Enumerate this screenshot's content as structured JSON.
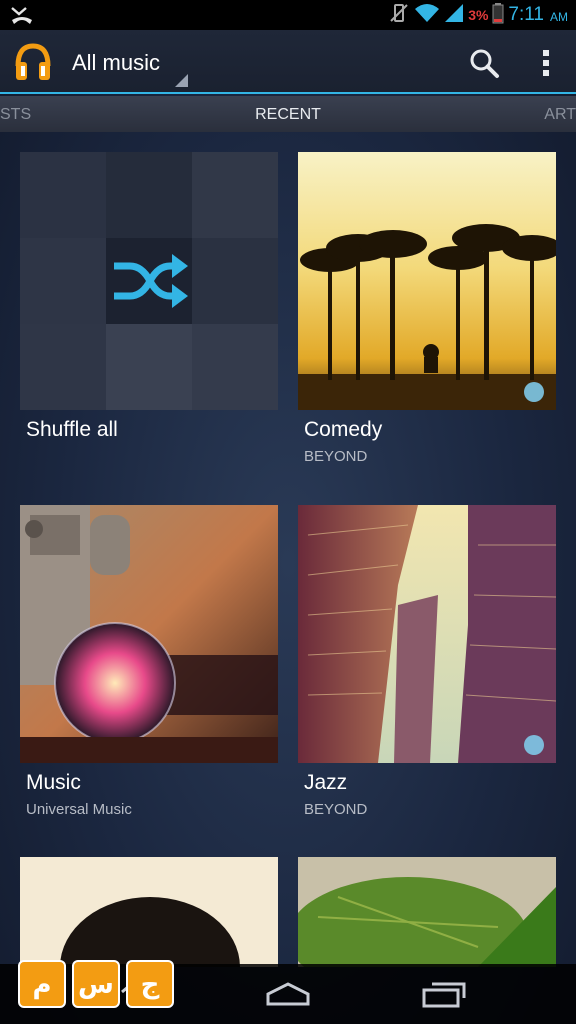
{
  "status_bar": {
    "battery_percent": "3%",
    "time": "7:11",
    "ampm": "AM"
  },
  "action_bar": {
    "title": "All music"
  },
  "tabs": {
    "left": "STS",
    "current": "RECENT",
    "right": "ART"
  },
  "tiles": [
    {
      "title": "Shuffle all",
      "subtitle": ""
    },
    {
      "title": "Comedy",
      "subtitle": "BEYOND"
    },
    {
      "title": "Music",
      "subtitle": "Universal Music"
    },
    {
      "title": "Jazz",
      "subtitle": "BEYOND"
    },
    {
      "title": "",
      "subtitle": ""
    },
    {
      "title": "",
      "subtitle": ""
    }
  ],
  "watermark": {
    "letters": [
      "م",
      "س",
      "ج"
    ]
  },
  "colors": {
    "accent": "#33b5e5",
    "battery_low": "#e03b3b",
    "app_icon_orange": "#f39c12"
  },
  "icons": {
    "status_left": "missed-call-icon",
    "app": "headphones-icon",
    "search": "search-icon",
    "overflow": "overflow-menu-icon",
    "shuffle": "shuffle-icon",
    "back": "back-icon",
    "home": "home-icon",
    "recents": "recent-apps-icon"
  }
}
